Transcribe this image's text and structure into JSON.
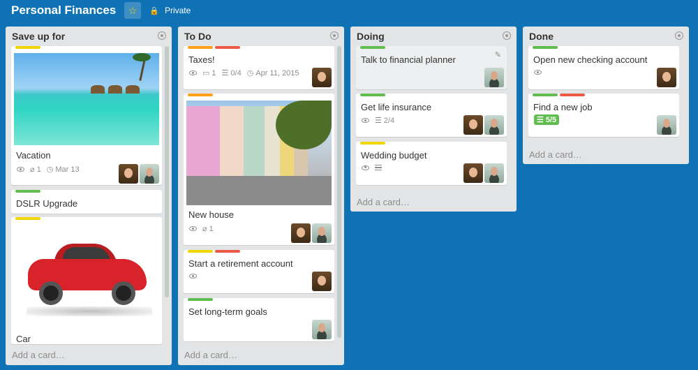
{
  "board": {
    "title": "Personal Finances",
    "star": "☆",
    "privacy": "Private",
    "lock": "🔒"
  },
  "add_card": "Add a card…",
  "lists": [
    {
      "title": "Save up for",
      "cards": [
        {
          "title": "Vacation",
          "badges": {
            "attachments": "1",
            "due": "Mar 13"
          }
        },
        {
          "title": "DSLR Upgrade"
        },
        {
          "title": "Car"
        }
      ]
    },
    {
      "title": "To Do",
      "cards": [
        {
          "title": "Taxes!",
          "badges": {
            "comments": "1",
            "checklist": "0/4",
            "due": "Apr 11, 2015"
          }
        },
        {
          "title": "New house",
          "badges": {
            "attachments": "1"
          }
        },
        {
          "title": "Start a retirement account"
        },
        {
          "title": "Set long-term goals"
        }
      ]
    },
    {
      "title": "Doing",
      "cards": [
        {
          "title": "Talk to financial planner"
        },
        {
          "title": "Get life insurance",
          "badges": {
            "checklist": "2/4"
          }
        },
        {
          "title": "Wedding budget"
        }
      ]
    },
    {
      "title": "Done",
      "cards": [
        {
          "title": "Open new checking account"
        },
        {
          "title": "Find a new job",
          "badges": {
            "checklist": "5/5"
          }
        }
      ]
    }
  ],
  "icons": {
    "watch": "eye-icon",
    "attachment": "paperclip-icon",
    "comment": "speech-bubble-icon",
    "checklist": "checklist-icon",
    "due": "clock-icon",
    "edit": "pencil-icon",
    "description": "description-icon"
  },
  "colors": {
    "board_bg": "#0f72b4",
    "list_bg": "#e2e4e6",
    "label_yellow": "#f2d600",
    "label_orange": "#ff9f1a",
    "label_red": "#eb5a46",
    "label_green": "#61bd4f"
  }
}
